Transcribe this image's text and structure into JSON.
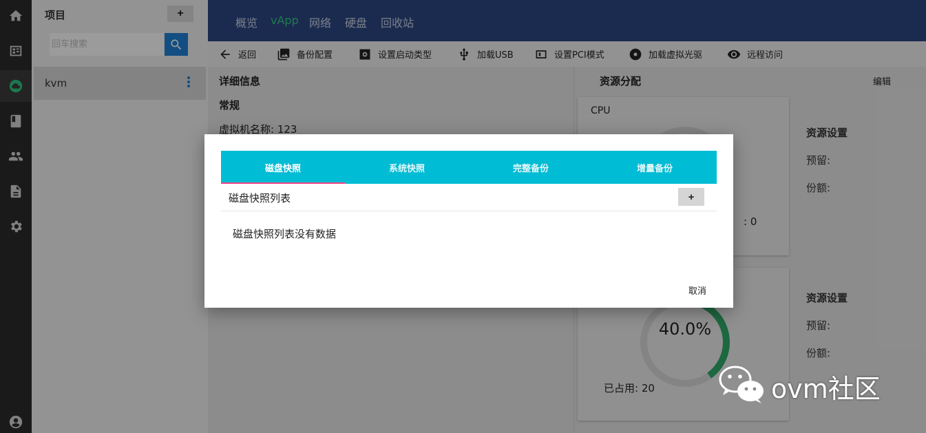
{
  "sidebar_icons": [
    "home-icon",
    "dashboard-icon",
    "cloud-icon",
    "book-icon",
    "users-icon",
    "document-icon",
    "gear-icon",
    "account-icon"
  ],
  "project": {
    "title": "项目",
    "add_label": "+",
    "search_placeholder": "回车搜索",
    "items": [
      {
        "label": "kvm"
      }
    ]
  },
  "topnav": {
    "tabs": [
      {
        "label": "概览"
      },
      {
        "label": "vApp"
      },
      {
        "label": "网络"
      },
      {
        "label": "硬盘"
      },
      {
        "label": "回收站"
      }
    ],
    "active_color": "#34c47a"
  },
  "toolbar": {
    "items": [
      {
        "label": "返回",
        "icon": "arrow-left-icon"
      },
      {
        "label": "备份配置",
        "icon": "image-stack-icon"
      },
      {
        "label": "设置启动类型",
        "icon": "cog-box-icon"
      },
      {
        "label": "加载USB",
        "icon": "usb-icon"
      },
      {
        "label": "设置PCI模式",
        "icon": "pci-icon"
      },
      {
        "label": "加载虚拟光驱",
        "icon": "disc-icon"
      },
      {
        "label": "远程访问",
        "icon": "eye-icon"
      }
    ]
  },
  "detail": {
    "title": "详细信息",
    "section": "常规",
    "vm_name_label": "虚拟机名称: ",
    "vm_name_value": "123"
  },
  "resources": {
    "title": "资源分配",
    "edit_label": "编辑",
    "cpu_label": "CPU",
    "cpu_trailing": ": 0",
    "card2_percent": 40.0,
    "card2_percent_text": "40.0%",
    "card2_used": "已占用: 20",
    "settings_title": "资源设置",
    "reserve_label": "预留:",
    "quota_label": "份额:"
  },
  "dialog": {
    "tabs": [
      {
        "label": "磁盘快照"
      },
      {
        "label": "系统快照"
      },
      {
        "label": "完整备份"
      },
      {
        "label": "增量备份"
      }
    ],
    "list_title": "磁盘快照列表",
    "add_label": "+",
    "empty_text": "磁盘快照列表没有数据",
    "cancel_label": "取消",
    "tab_color": "#00bcd4",
    "indicator_color": "#ff4081"
  },
  "watermark": {
    "text": "ovm社区"
  }
}
